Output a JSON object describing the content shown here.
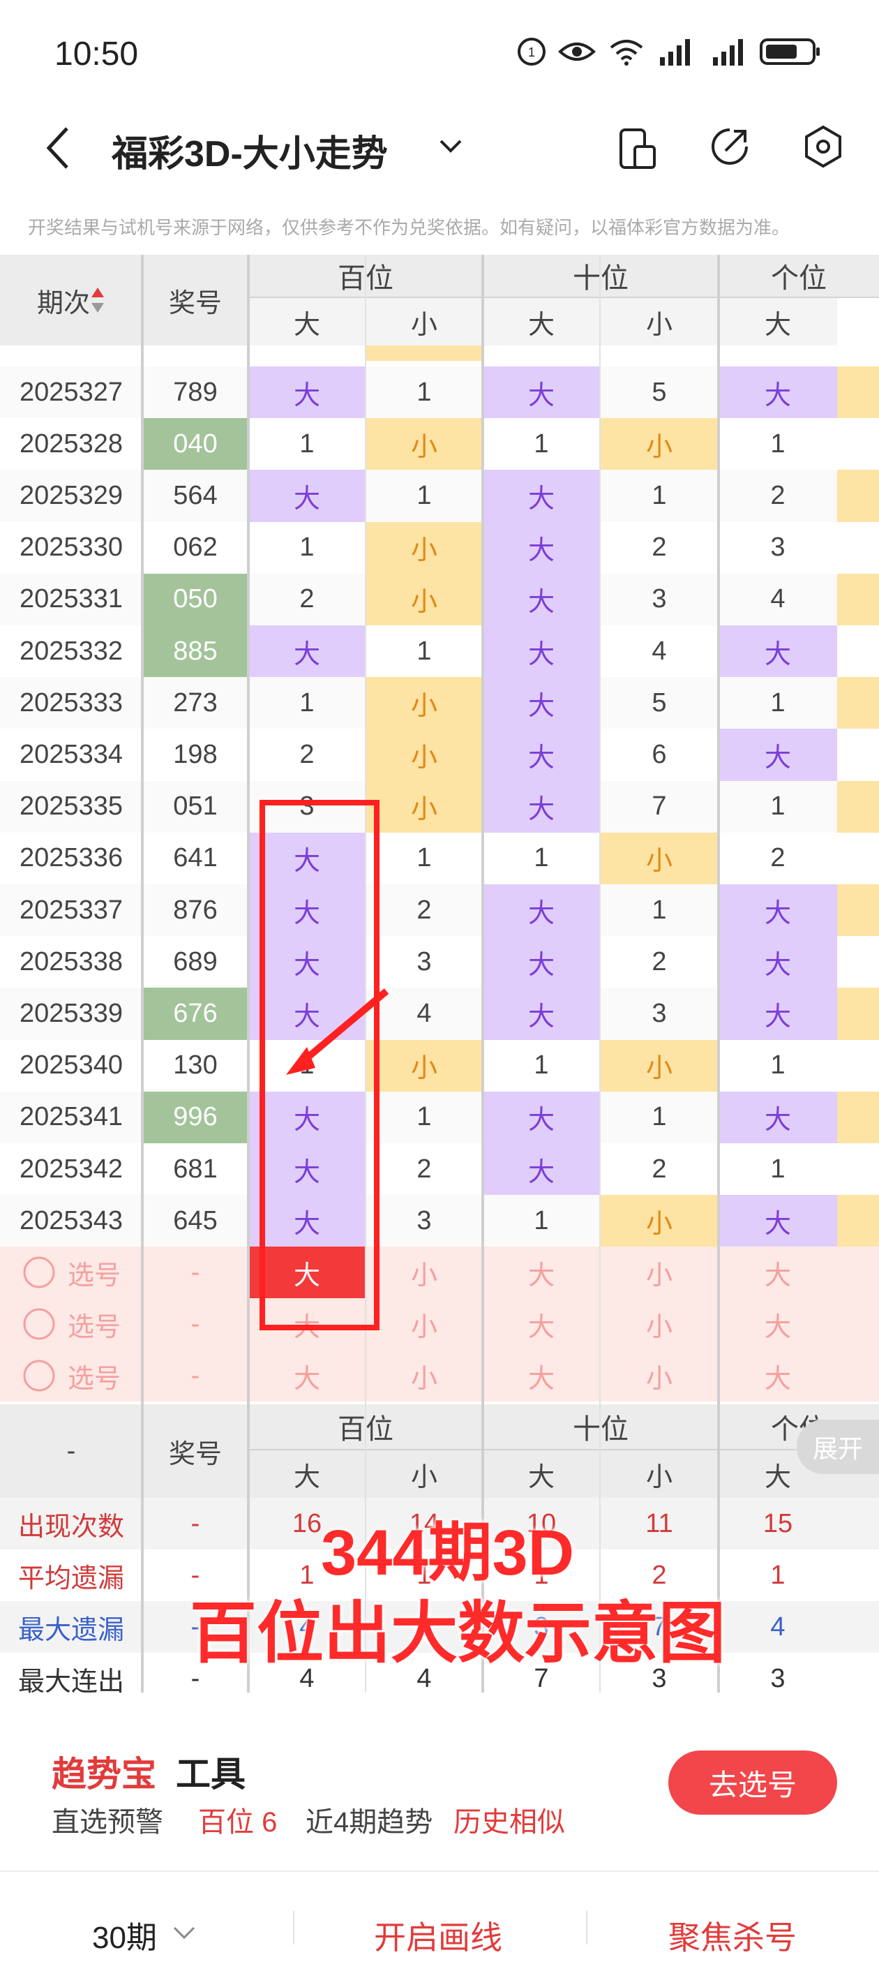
{
  "status": {
    "time": "10:50",
    "battery": "▮"
  },
  "header": {
    "title": "福彩3D-大小走势",
    "disclaimer": "开奖结果与试机号来源于网络，仅供参考不作为兑奖依据。如有疑问，以福体彩官方数据为准。"
  },
  "table": {
    "col_period": "期次",
    "col_number": "奖号",
    "group_bai": "百位",
    "group_shi": "十位",
    "group_ge": "个位",
    "big": "大",
    "small": "小",
    "rows": [
      {
        "p": "2025327",
        "n": "789",
        "green": false,
        "c": [
          "大",
          "1",
          "大",
          "5",
          "大"
        ]
      },
      {
        "p": "2025328",
        "n": "040",
        "green": true,
        "c": [
          "1",
          "小",
          "1",
          "小",
          "1"
        ]
      },
      {
        "p": "2025329",
        "n": "564",
        "green": false,
        "c": [
          "大",
          "1",
          "大",
          "1",
          "2"
        ]
      },
      {
        "p": "2025330",
        "n": "062",
        "green": false,
        "c": [
          "1",
          "小",
          "大",
          "2",
          "3"
        ]
      },
      {
        "p": "2025331",
        "n": "050",
        "green": true,
        "c": [
          "2",
          "小",
          "大",
          "3",
          "4"
        ]
      },
      {
        "p": "2025332",
        "n": "885",
        "green": true,
        "c": [
          "大",
          "1",
          "大",
          "4",
          "大"
        ]
      },
      {
        "p": "2025333",
        "n": "273",
        "green": false,
        "c": [
          "1",
          "小",
          "大",
          "5",
          "1"
        ]
      },
      {
        "p": "2025334",
        "n": "198",
        "green": false,
        "c": [
          "2",
          "小",
          "大",
          "6",
          "大"
        ]
      },
      {
        "p": "2025335",
        "n": "051",
        "green": false,
        "c": [
          "3",
          "小",
          "大",
          "7",
          "1"
        ]
      },
      {
        "p": "2025336",
        "n": "641",
        "green": false,
        "c": [
          "大",
          "1",
          "1",
          "小",
          "2"
        ]
      },
      {
        "p": "2025337",
        "n": "876",
        "green": false,
        "c": [
          "大",
          "2",
          "大",
          "1",
          "大"
        ]
      },
      {
        "p": "2025338",
        "n": "689",
        "green": false,
        "c": [
          "大",
          "3",
          "大",
          "2",
          "大"
        ]
      },
      {
        "p": "2025339",
        "n": "676",
        "green": true,
        "c": [
          "大",
          "4",
          "大",
          "3",
          "大"
        ]
      },
      {
        "p": "2025340",
        "n": "130",
        "green": false,
        "c": [
          "1",
          "小",
          "1",
          "小",
          "1"
        ]
      },
      {
        "p": "2025341",
        "n": "996",
        "green": true,
        "c": [
          "大",
          "1",
          "大",
          "1",
          "大"
        ]
      },
      {
        "p": "2025342",
        "n": "681",
        "green": false,
        "c": [
          "大",
          "2",
          "大",
          "2",
          "1"
        ]
      },
      {
        "p": "2025343",
        "n": "645",
        "green": false,
        "c": [
          "大",
          "3",
          "1",
          "小",
          "大"
        ]
      }
    ],
    "pick_label": "选号",
    "dash": "-",
    "pick_cells": [
      "大",
      "小",
      "大",
      "小",
      "大"
    ],
    "expand": "展开"
  },
  "stats": {
    "rows": [
      {
        "label": "出现次数",
        "color": "#d23a3a",
        "v": [
          "16",
          "14",
          "10",
          "11",
          "15"
        ]
      },
      {
        "label": "平均遗漏",
        "color": "#d23a3a",
        "v": [
          "1",
          "1",
          "1",
          "2",
          "1"
        ]
      },
      {
        "label": "最大遗漏",
        "color": "#3a62c9",
        "v": [
          "4",
          "3",
          "3",
          "7",
          "4"
        ]
      },
      {
        "label": "最大连出",
        "color": "#333333",
        "v": [
          "4",
          "4",
          "7",
          "3",
          "3"
        ]
      }
    ]
  },
  "overlay": {
    "line1": "344期3D",
    "line2": "百位出大数示意图"
  },
  "tool": {
    "brand": "趋势宝",
    "brand_suffix": "工具",
    "warn": "直选预警",
    "warn_val": "百位 6",
    "trend": "近4期趋势",
    "trend_val": "历史相似",
    "button": "去选号"
  },
  "bottom": {
    "periods": "30期",
    "draw": "开启画线",
    "kill": "聚焦杀号"
  }
}
